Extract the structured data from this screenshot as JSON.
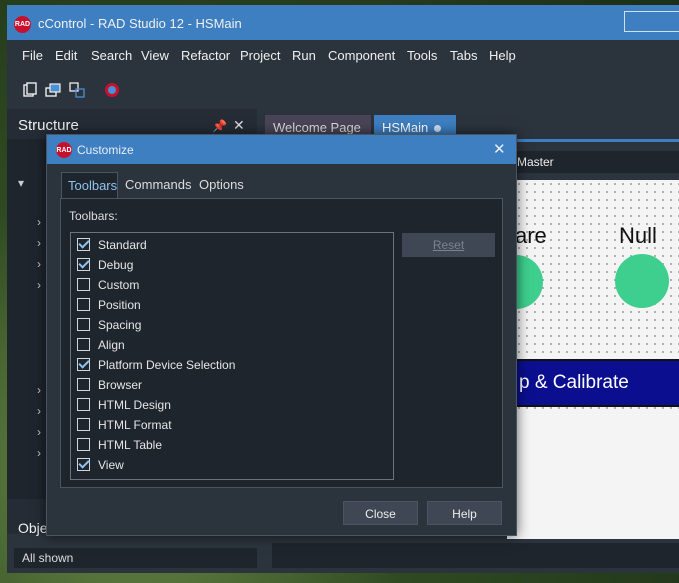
{
  "window": {
    "title": "cControl - RAD Studio 12 - HSMain",
    "logo_text": "RAD"
  },
  "menu": [
    "File",
    "Edit",
    "Search",
    "View",
    "Refactor",
    "Project",
    "Run",
    "Component",
    "Tools",
    "Tabs",
    "Help"
  ],
  "toolbar_icons": [
    "new-items-icon",
    "open-icon",
    "switch-form-icon",
    "platform-globe-icon"
  ],
  "structure": {
    "title": "Structure",
    "pin": "📌",
    "close": "✕"
  },
  "object_inspector": {
    "title": "Obje",
    "filter": "All shown"
  },
  "editor_tabs": [
    {
      "label": "Welcome Page"
    },
    {
      "label": "HSMain"
    }
  ],
  "designer": {
    "master_label": "Master",
    "label_left": "are",
    "label_right": "Null",
    "button_text": "p & Calibrate",
    "accent_color": "#3ecf8e",
    "button_color": "#0b0f8f"
  },
  "dialog": {
    "title": "Customize",
    "close_glyph": "✕",
    "tabs": [
      {
        "label": "Toolbars",
        "active": true
      },
      {
        "label": "Commands",
        "active": false
      },
      {
        "label": "Options",
        "active": false
      }
    ],
    "toolbars_label": "Toolbars:",
    "reset_label": "Reset",
    "close_label": "Close",
    "help_label": "Help",
    "items": [
      {
        "label": "Standard",
        "checked": true
      },
      {
        "label": "Debug",
        "checked": true
      },
      {
        "label": "Custom",
        "checked": false
      },
      {
        "label": "Position",
        "checked": false
      },
      {
        "label": "Spacing",
        "checked": false
      },
      {
        "label": "Align",
        "checked": false
      },
      {
        "label": "Platform Device Selection",
        "checked": true
      },
      {
        "label": "Browser",
        "checked": false
      },
      {
        "label": "HTML Design",
        "checked": false
      },
      {
        "label": "HTML Format",
        "checked": false
      },
      {
        "label": "HTML Table",
        "checked": false
      },
      {
        "label": "View",
        "checked": true
      }
    ]
  }
}
